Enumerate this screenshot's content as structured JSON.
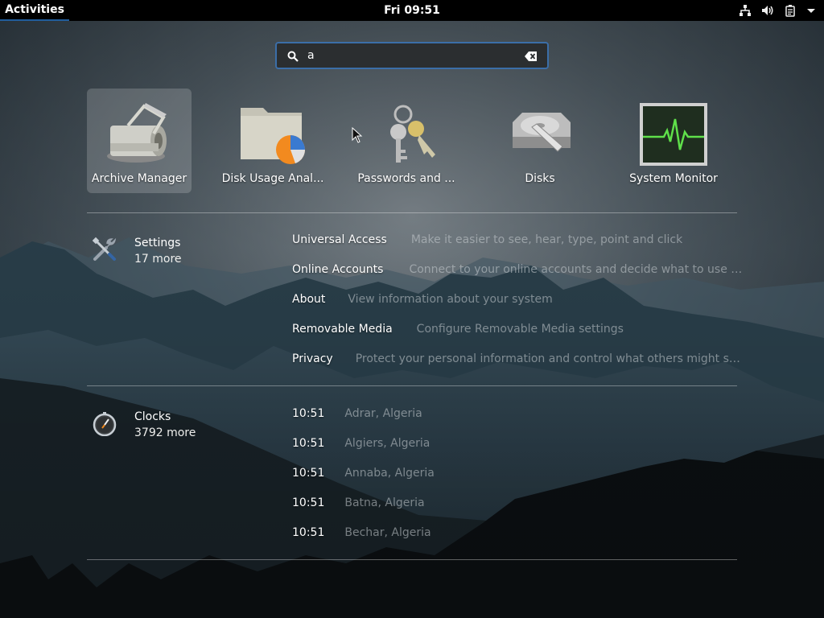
{
  "topbar": {
    "activities_label": "Activities",
    "clock": "Fri 09:51",
    "tray_icons": [
      "network-wired-icon",
      "volume-icon",
      "battery-icon",
      "system-menu-arrow-icon"
    ]
  },
  "search": {
    "value": "a",
    "icon": "search-icon",
    "clear_icon": "edit-clear-icon"
  },
  "apps": [
    {
      "label": "Archive Manager",
      "icon": "archive-manager-icon",
      "selected": true
    },
    {
      "label": "Disk Usage Anal...",
      "icon": "disk-usage-analyzer-icon"
    },
    {
      "label": "Passwords and ...",
      "icon": "passwords-keys-icon"
    },
    {
      "label": "Disks",
      "icon": "disks-icon"
    },
    {
      "label": "System Monitor",
      "icon": "system-monitor-icon"
    }
  ],
  "settings_provider": {
    "name": "Settings",
    "more": "17 more",
    "icon": "settings-tools-icon",
    "results": [
      {
        "title": "Universal Access",
        "description": "Make it easier to see, hear, type, point and click"
      },
      {
        "title": "Online Accounts",
        "description": "Connect to your online accounts and decide what to use them ..."
      },
      {
        "title": "About",
        "description": "View information about your system"
      },
      {
        "title": "Removable Media",
        "description": "Configure Removable Media settings"
      },
      {
        "title": "Privacy",
        "description": "Protect your personal information and control what others might see"
      }
    ]
  },
  "clocks_provider": {
    "name": "Clocks",
    "more": "3792 more",
    "icon": "clocks-icon",
    "results": [
      {
        "time": "10:51",
        "place": "Adrar, Algeria"
      },
      {
        "time": "10:51",
        "place": "Algiers, Algeria"
      },
      {
        "time": "10:51",
        "place": "Annaba, Algeria"
      },
      {
        "time": "10:51",
        "place": "Batna, Algeria"
      },
      {
        "time": "10:51",
        "place": "Bechar, Algeria"
      }
    ]
  },
  "colors": {
    "focus_accent": "#215d9c",
    "search_border": "#3b6ea8",
    "topbar_bg": "#000000"
  }
}
